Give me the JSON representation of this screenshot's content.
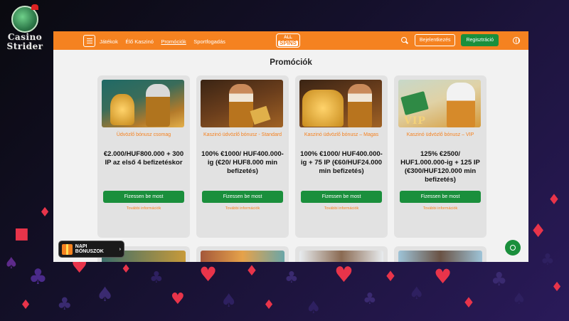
{
  "watermark": {
    "line1": "Casino",
    "line2": "Strider"
  },
  "header": {
    "nav": [
      "Játékok",
      "Élő Kaszinó",
      "Promóciók",
      "Sportfogadás"
    ],
    "active_nav": "Promóciók",
    "brand_top": "ALL",
    "brand_bottom": "SPINS",
    "login": "Bejelentkezés",
    "register": "Regisztráció"
  },
  "page": {
    "title": "Promóciók"
  },
  "cards": [
    {
      "subtitle": "Üdvözlő bónusz csomag",
      "title": "€2.000/HUF800.000 + 300 IP az első 4 befizetéskor",
      "button": "Fizessen be most",
      "link": "További információk"
    },
    {
      "subtitle": "Kaszinó üdvözlő bónusz - Standard",
      "title": "100% €1000/ HUF400.000-ig (€20/ HUF8.000 min befizetés)",
      "button": "Fizessen be most",
      "link": "További információk"
    },
    {
      "subtitle": "Kaszinó üdvözlő bónusz – Magas",
      "title": "100% €1000/ HUF400.000-ig + 75 IP (€60/HUF24.000 min befizetés)",
      "button": "Fizessen be most",
      "link": "További információk"
    },
    {
      "subtitle": "Kaszinó üdvözlő bónusz – VIP",
      "title": "125% €2500/ HUF1.000.000-ig + 125 IP (€300/HUF120.000 min befizetés)",
      "button": "Fizessen be most",
      "link": "További információk"
    }
  ],
  "bonus_pill": {
    "label": "NAPI BÓNUSZOK",
    "chevron": "›"
  },
  "icons": {
    "menu": "menu-icon",
    "search": "search-icon",
    "globe": "globe-icon",
    "gift": "gift-icon",
    "chat": "chat-icon"
  },
  "colors": {
    "accent": "#f58220",
    "cta": "#1a8f3c",
    "page_bg": "#f2f2f2",
    "card_bg": "#e2e2e2"
  }
}
